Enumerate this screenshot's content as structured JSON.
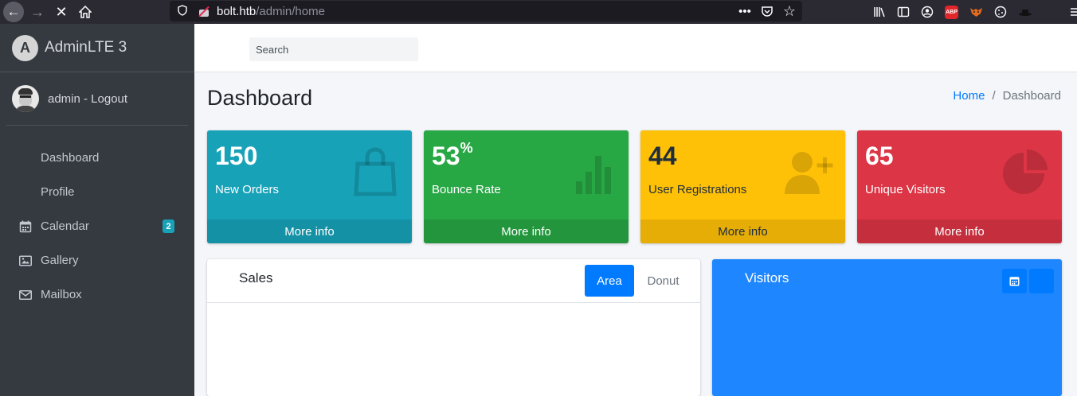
{
  "browser": {
    "url_host": "bolt.htb",
    "url_path": "/admin/home",
    "abp_label": "ABP"
  },
  "sidebar": {
    "brand": "AdminLTE 3",
    "brand_logo_letter": "A",
    "user": "admin - Logout",
    "items": [
      {
        "label": "Dashboard",
        "icon": "none"
      },
      {
        "label": "Profile",
        "icon": "none"
      },
      {
        "label": "Calendar",
        "icon": "calendar-icon",
        "badge": "2"
      },
      {
        "label": "Gallery",
        "icon": "image-icon"
      },
      {
        "label": "Mailbox",
        "icon": "envelope-icon"
      }
    ],
    "badge_color": "#17a2b8"
  },
  "topnav": {
    "search_placeholder": "Search"
  },
  "page": {
    "title": "Dashboard",
    "breadcrumb": [
      "Home",
      "/",
      "Dashboard"
    ]
  },
  "stats": [
    {
      "value": "150",
      "suffix": "",
      "label": "New Orders",
      "footer": "More info",
      "color": "#17a2b8",
      "icon": "shopping-bag-icon"
    },
    {
      "value": "53",
      "suffix": "%",
      "label": "Bounce Rate",
      "footer": "More info",
      "color": "#28a745",
      "icon": "bar-chart-icon"
    },
    {
      "value": "44",
      "suffix": "",
      "label": "User Registrations",
      "footer": "More info",
      "color": "#ffc107",
      "icon": "user-plus-icon"
    },
    {
      "value": "65",
      "suffix": "",
      "label": "Unique Visitors",
      "footer": "More info",
      "color": "#dc3545",
      "icon": "pie-chart-icon"
    }
  ],
  "sales": {
    "title": "Sales",
    "tabs": [
      "Area",
      "Donut"
    ],
    "active_tab": "Area"
  },
  "visitors": {
    "title": "Visitors",
    "color": "#1e86ff"
  }
}
